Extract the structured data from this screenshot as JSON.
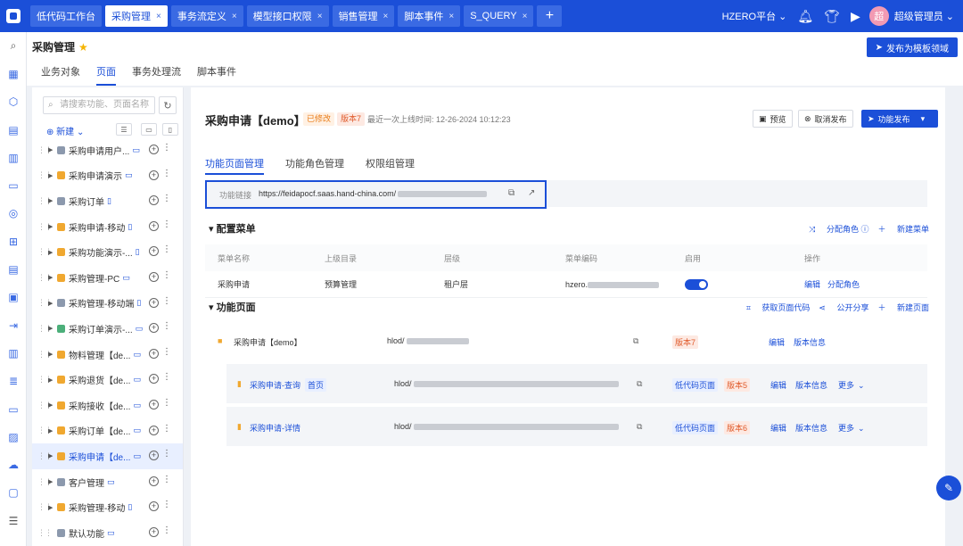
{
  "topbar": {
    "tabs": [
      {
        "label": "低代码工作台",
        "closable": false,
        "active": false
      },
      {
        "label": "采购管理",
        "closable": true,
        "active": true
      },
      {
        "label": "事务流定义",
        "closable": true,
        "active": false
      },
      {
        "label": "模型接口权限",
        "closable": true,
        "active": false
      },
      {
        "label": "销售管理",
        "closable": true,
        "active": false
      },
      {
        "label": "脚本事件",
        "closable": true,
        "active": false
      },
      {
        "label": "S_QUERY",
        "closable": true,
        "active": false
      }
    ],
    "add_tab": "+",
    "platform": "HZERO平台 ⌄",
    "avatar_text": "超",
    "user_name": "超级管理员 ⌄",
    "close_glyph": "×",
    "accent": "#1b4fd8"
  },
  "page": {
    "title": "采购管理",
    "publish_template": "发布为模板领域",
    "subtabs": [
      "业务对象",
      "页面",
      "事务处理流",
      "脚本事件"
    ],
    "active_subtab": 1
  },
  "tree": {
    "search_placeholder": "请搜索功能、页面名称",
    "new_label": "新建",
    "items": [
      {
        "label": "采购申请用户...",
        "cube": "g",
        "device": "▭",
        "selected": false,
        "arrow": true
      },
      {
        "label": "采购申请演示",
        "cube": "o",
        "device": "▭",
        "selected": false,
        "arrow": true
      },
      {
        "label": "采购订单",
        "cube": "g",
        "device": "▯",
        "selected": false,
        "arrow": true
      },
      {
        "label": "采购申请-移动",
        "cube": "o",
        "device": "▯",
        "selected": false,
        "arrow": true
      },
      {
        "label": "采购功能演示-...",
        "cube": "o",
        "device": "▯",
        "selected": false,
        "arrow": true
      },
      {
        "label": "采购管理-PC",
        "cube": "o",
        "device": "▭",
        "selected": false,
        "arrow": true
      },
      {
        "label": "采购管理-移动端",
        "cube": "g",
        "device": "▯",
        "selected": false,
        "arrow": true
      },
      {
        "label": "采购订单演示-...",
        "cube": "gr",
        "device": "▭",
        "selected": false,
        "arrow": true
      },
      {
        "label": "物料管理【de...",
        "cube": "o",
        "device": "▭",
        "selected": false,
        "arrow": true
      },
      {
        "label": "采购退货【de...",
        "cube": "o",
        "device": "▭",
        "selected": false,
        "arrow": true
      },
      {
        "label": "采购接收【de...",
        "cube": "o",
        "device": "▭",
        "selected": false,
        "arrow": true
      },
      {
        "label": "采购订单【de...",
        "cube": "o",
        "device": "▭",
        "selected": false,
        "arrow": true
      },
      {
        "label": "采购申请【de...",
        "cube": "o",
        "device": "▭",
        "selected": true,
        "arrow": true
      },
      {
        "label": "客户管理",
        "cube": "g",
        "device": "▭",
        "selected": false,
        "arrow": true
      },
      {
        "label": "采购管理-移动",
        "cube": "o",
        "device": "▯",
        "selected": false,
        "arrow": true
      },
      {
        "label": "默认功能",
        "cube": "g",
        "device": "▭",
        "selected": false,
        "arrow": false
      }
    ]
  },
  "main": {
    "title": "采购申请【demo】",
    "modified": "已修改",
    "version": "版本7",
    "last_online": "最近一次上线时间: 12-26-2024 10:12:23",
    "btn_preview": "预览",
    "btn_cancel": "取消发布",
    "btn_publish": "功能发布",
    "tabs": [
      "功能页面管理",
      "功能角色管理",
      "权限组管理"
    ],
    "link_label": "功能链接",
    "link_url": "https://feidapocf.saas.hand-china.com/",
    "menu_section": "配置菜单",
    "menu_actions": [
      "分配角色",
      "新建菜单"
    ],
    "menu_headers": [
      "菜单名称",
      "上级目录",
      "层级",
      "菜单编码",
      "启用",
      "操作"
    ],
    "menu_row": {
      "name": "采购申请",
      "parent": "预算管理",
      "level": "租户层",
      "code": "hzero.",
      "enabled": true,
      "edit": "编辑",
      "assign": "分配角色"
    },
    "page_section": "功能页面",
    "page_actions": [
      "获取页面代码",
      "公开分享",
      "新建页面"
    ],
    "pages": [
      {
        "name": "采购申请【demo】",
        "code": "hlod/",
        "tag": "",
        "type": "",
        "version": "版本7",
        "edit": "编辑",
        "info": "版本信息",
        "more": ""
      },
      {
        "name": "采购申请-查询",
        "code": "hlod/",
        "tag": "首页",
        "type": "低代码页面",
        "version": "版本5",
        "edit": "编辑",
        "info": "版本信息",
        "more": "更多"
      },
      {
        "name": "采购申请-详情",
        "code": "hlod/",
        "tag": "",
        "type": "低代码页面",
        "version": "版本6",
        "edit": "编辑",
        "info": "版本信息",
        "more": "更多"
      }
    ]
  }
}
